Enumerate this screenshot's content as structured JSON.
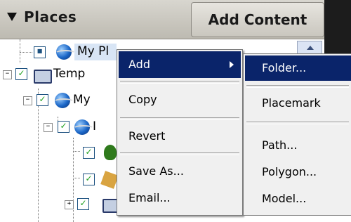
{
  "header": {
    "title": "Places",
    "add_content_label": "Add Content"
  },
  "tree": {
    "rows": [
      {
        "label": "My Pl"
      },
      {
        "label": "Temp"
      },
      {
        "label": "My"
      },
      {
        "label": "I"
      }
    ]
  },
  "context_menu": {
    "items": [
      {
        "label": "Add"
      },
      {
        "label": "Copy"
      },
      {
        "label": "Revert"
      },
      {
        "label": "Save As..."
      },
      {
        "label": "Email..."
      }
    ]
  },
  "submenu": {
    "items": [
      {
        "label": "Folder..."
      },
      {
        "label": "Placemark"
      },
      {
        "label": "Path..."
      },
      {
        "label": "Polygon..."
      },
      {
        "label": "Model..."
      }
    ]
  },
  "colors": {
    "selection": "#0a246a",
    "menu_bg": "#f0f0f0",
    "checkbox_border": "#1c5180",
    "check_green": "#21a121"
  }
}
